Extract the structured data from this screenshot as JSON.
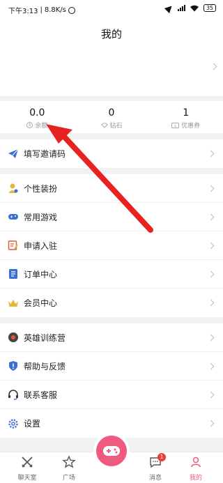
{
  "status": {
    "time": "下午3:13",
    "speed": "8.8K/s",
    "battery": "35"
  },
  "header": {
    "title": "我的"
  },
  "stats": [
    {
      "value": "0.0",
      "label": "余额",
      "icon": "coin-icon"
    },
    {
      "value": "0",
      "label": "钻石",
      "icon": "diamond-icon"
    },
    {
      "value": "1",
      "label": "优惠券",
      "icon": "coupon-icon"
    }
  ],
  "menu": {
    "invite": "填写邀请码",
    "dress": "个性装扮",
    "games": "常用游戏",
    "apply": "申请入驻",
    "orders": "订单中心",
    "vip": "会员中心",
    "training": "英雄训练营",
    "help": "帮助与反馈",
    "service": "联系客服",
    "settings": "设置"
  },
  "tabs": {
    "chat": "聊天室",
    "square": "广场",
    "messages": "消息",
    "messages_badge": "1",
    "mine": "我的"
  },
  "colors": {
    "accent": "#ef5b7f",
    "arrow": "#e82121",
    "blue_icon": "#3b6fd1",
    "badge": "#f03a3a"
  }
}
